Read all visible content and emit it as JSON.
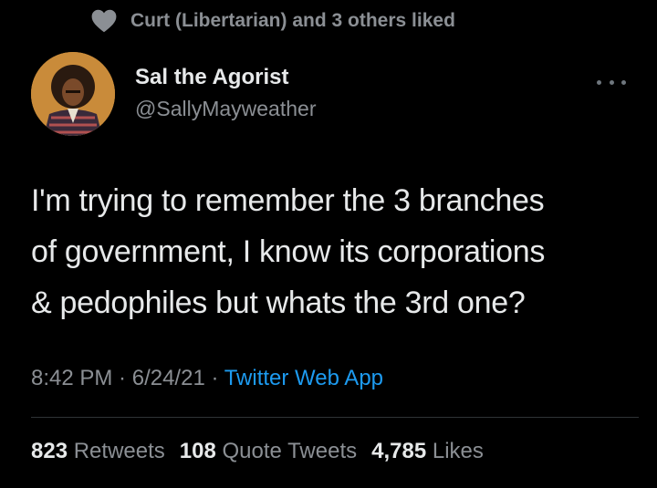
{
  "social_context": {
    "icon": "heart-icon",
    "text": "Curt (Libertarian) and 3 others liked"
  },
  "author": {
    "display_name": "Sal the Agorist",
    "handle": "@SallyMayweather"
  },
  "tweet": {
    "lines": [
      "I'm trying to remember the 3 branches",
      "of government, I know its corporations",
      "& pedophiles but whats the 3rd one?"
    ]
  },
  "meta": {
    "time": "8:42 PM",
    "separator": " · ",
    "date": "6/24/21",
    "source": "Twitter Web App"
  },
  "stats": {
    "retweets_count": "823",
    "retweets_label": "Retweets",
    "quotes_count": "108",
    "quotes_label": "Quote Tweets",
    "likes_count": "4,785",
    "likes_label": "Likes"
  },
  "colors": {
    "background": "#000000",
    "text_primary": "#e7e9ea",
    "text_secondary": "#8b8f94",
    "link": "#1d9bf0",
    "divider": "#2f3336"
  }
}
